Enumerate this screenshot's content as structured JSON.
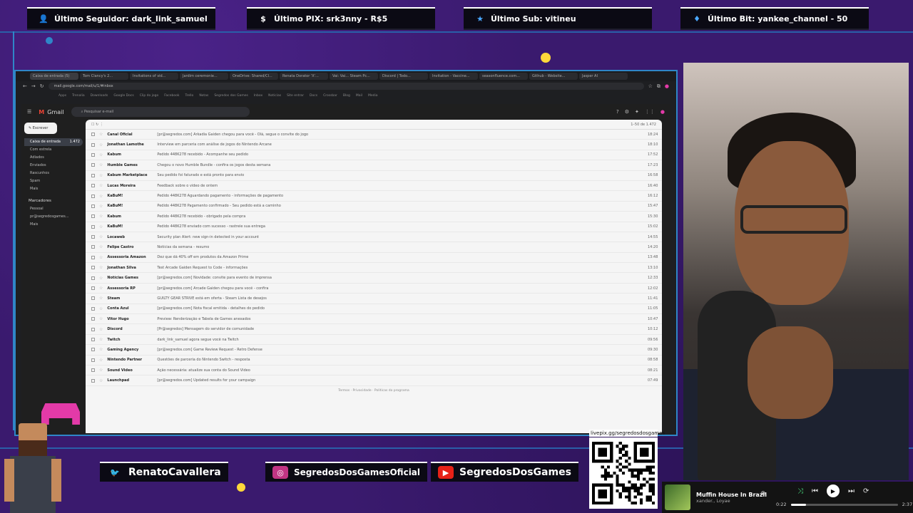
{
  "alerts": {
    "follower": "Último Seguidor: dark_link_samuel",
    "pix": "Último PIX: srk3nny - R$5",
    "sub": "Último Sub: vitineu",
    "bit": "Último Bit: yankee_channel - 50"
  },
  "browser": {
    "tabs": [
      "Caixa de entrada (5)",
      "Tom Clancy's 2...",
      "Invitations of vid...",
      "Jardim ceremonie...",
      "OneDrive: Shared/Cl...",
      "Renata Dorator 'X'...",
      "Vai: Vai... Steam Pc...",
      "Discord | Todo...",
      "Invitation - Vaccine...",
      "seasonfluence.com...",
      "Github - Website...",
      "Jasper AI"
    ],
    "url": "mail.google.com/mail/u/1/#inbox",
    "bookmarks": [
      "Apps",
      "Trenalia",
      "Downloads",
      "Google Docs",
      "Clip do jogo",
      "Facebook",
      "Trello",
      "Notas",
      "Segredos dos Games",
      "Inbox",
      "Noticias",
      "Site entrar",
      "Docs",
      "Crossbar",
      "Blog",
      "Mail",
      "Media"
    ]
  },
  "gmail": {
    "title": "Gmail",
    "search_placeholder": "Pesquisar e-mail",
    "compose": "Escrever",
    "sidebar": [
      "Caixa de entrada",
      "Com estrela",
      "Adiados",
      "Enviados",
      "Rascunhos",
      "Spam",
      "Mais"
    ],
    "inbox_count": "1.472",
    "labels_title": "Marcadores",
    "labels": [
      "Pessoal",
      "pr@segredosgames...",
      "Mais"
    ],
    "list_range": "1–50 de 1.472",
    "rows": [
      {
        "sender": "Canal Oficial",
        "subject": "[pr@segredos.com] Arkadia Gaiden chegou para você - Olá, segue o convite do jogo",
        "date": "18:24"
      },
      {
        "sender": "Jonathan Lamothe",
        "subject": "Interview em parceria com análise de jogos do Nintendo Arcane",
        "date": "18:10"
      },
      {
        "sender": "Kabum",
        "subject": "Pedido 448K278 recebido - Acompanhe seu pedido",
        "date": "17:52"
      },
      {
        "sender": "Humble Games",
        "subject": "Chegou o novo Humble Bundle - confira os jogos desta semana",
        "date": "17:23"
      },
      {
        "sender": "Kabum Marketplace",
        "subject": "Seu pedido foi faturado e está pronto para envio",
        "date": "16:58"
      },
      {
        "sender": "Lucas Moreira",
        "subject": "Feedback sobre o vídeo de ontem",
        "date": "16:40"
      },
      {
        "sender": "KaBuM!",
        "subject": "Pedido 448K278 Aguardando pagamento - informações de pagamento",
        "date": "16:12"
      },
      {
        "sender": "KaBuM!",
        "subject": "Pedido 448K278 Pagamento confirmado - Seu pedido está a caminho",
        "date": "15:47"
      },
      {
        "sender": "Kabum",
        "subject": "Pedido 448K278 recebido - obrigado pela compra",
        "date": "15:30"
      },
      {
        "sender": "KaBuM!",
        "subject": "Pedido 448K278 enviado com sucesso - rastreie sua entrega",
        "date": "15:02"
      },
      {
        "sender": "Locaweb",
        "subject": "Security plan Alert: new sign-in detected in your account",
        "date": "14:55"
      },
      {
        "sender": "Felipe Castro",
        "subject": "Notícias da semana - resumo",
        "date": "14:20"
      },
      {
        "sender": "Assessoria Amazon",
        "subject": "Dez que dá 40% off em produtos da Amazon Prime",
        "date": "13:48"
      },
      {
        "sender": "Jonathan Silva",
        "subject": "Test Arcade Gaiden Request to Code - informações",
        "date": "13:10"
      },
      {
        "sender": "Notícias Games",
        "subject": "[pr@segredos.com] Novidade: convite para evento de imprensa",
        "date": "12:33"
      },
      {
        "sender": "Assessoria RP",
        "subject": "[pr@segredos.com] Arcade Gaiden chegou para você - confira",
        "date": "12:02"
      },
      {
        "sender": "Steam",
        "subject": "GUILTY GEAR STRIVE está em oferta - Steam Lista de desejos",
        "date": "11:41"
      },
      {
        "sender": "Conta Azul",
        "subject": "[pr@segredos.com] Nota fiscal emitida - detalhes do pedido",
        "date": "11:05"
      },
      {
        "sender": "Vitor Hugo",
        "subject": "Preview: Renderização e Tabela de Games anexados",
        "date": "10:47"
      },
      {
        "sender": "Discord",
        "subject": "[Pr@segredos] Mensagem do servidor de comunidade",
        "date": "10:12"
      },
      {
        "sender": "Twitch",
        "subject": "dark_link_samuel agora segue você na Twitch",
        "date": "09:56"
      },
      {
        "sender": "Gaming Agency",
        "subject": "[pr@segredos.com] Game Review Request - Retro Defense",
        "date": "09:30"
      },
      {
        "sender": "Nintendo Partner",
        "subject": "Questões de parceria do Nintendo Switch - resposta",
        "date": "08:58"
      },
      {
        "sender": "Sound Video",
        "subject": "Ação necessária: atualize sua conta do Sound Video",
        "date": "08:21"
      },
      {
        "sender": "Launchpad",
        "subject": "[pr@segredos.com] Updated results for your campaign",
        "date": "07:49"
      }
    ],
    "footer": "Termos · Privacidade · Políticas do programa"
  },
  "socials": {
    "twitter": "RenatoCavallera",
    "instagram": "SegredosDosGamesOficial",
    "youtube": "SegredosDosGames"
  },
  "qr": {
    "label": "livepix.gg/segredosdosgames"
  },
  "player": {
    "title": "Muffin House In Brazil",
    "artist": "xander., Loyae",
    "elapsed": "0:22",
    "total": "2:37",
    "progress": 0.14
  },
  "colors": {
    "background": "#3a1a6e",
    "accent": "#2f86c8",
    "alert_bg": "#0b0a14",
    "youtube": "#e62117",
    "instagram": "#c13584",
    "twitter": "#1da1f2"
  }
}
